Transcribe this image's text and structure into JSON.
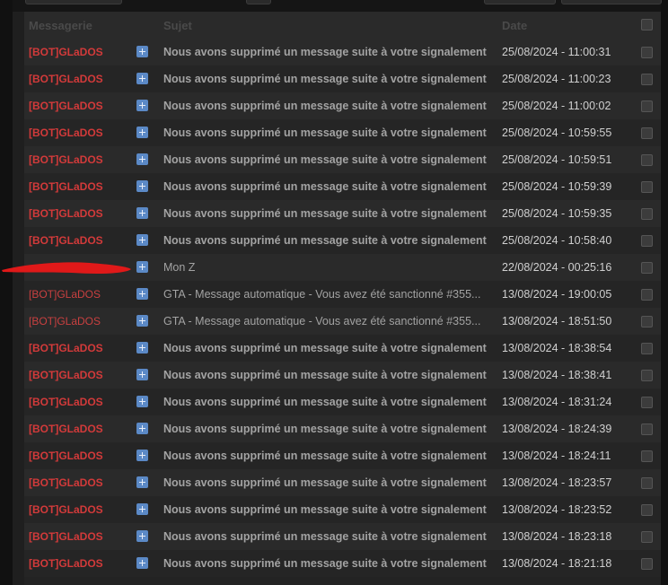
{
  "table": {
    "headers": {
      "sender": "Messagerie",
      "subject": "Sujet",
      "date": "Date"
    },
    "rows": [
      {
        "sender": "[BOT]GLaDOS",
        "subject": "Nous avons supprimé un message suite à votre signalement",
        "date": "25/08/2024 - 11:00:31",
        "unread": true
      },
      {
        "sender": "[BOT]GLaDOS",
        "subject": "Nous avons supprimé un message suite à votre signalement",
        "date": "25/08/2024 - 11:00:23",
        "unread": true
      },
      {
        "sender": "[BOT]GLaDOS",
        "subject": "Nous avons supprimé un message suite à votre signalement",
        "date": "25/08/2024 - 11:00:02",
        "unread": true
      },
      {
        "sender": "[BOT]GLaDOS",
        "subject": "Nous avons supprimé un message suite à votre signalement",
        "date": "25/08/2024 - 10:59:55",
        "unread": true
      },
      {
        "sender": "[BOT]GLaDOS",
        "subject": "Nous avons supprimé un message suite à votre signalement",
        "date": "25/08/2024 - 10:59:51",
        "unread": true
      },
      {
        "sender": "[BOT]GLaDOS",
        "subject": "Nous avons supprimé un message suite à votre signalement",
        "date": "25/08/2024 - 10:59:39",
        "unread": true
      },
      {
        "sender": "[BOT]GLaDOS",
        "subject": "Nous avons supprimé un message suite à votre signalement",
        "date": "25/08/2024 - 10:59:35",
        "unread": true
      },
      {
        "sender": "[BOT]GLaDOS",
        "subject": "Nous avons supprimé un message suite à votre signalement",
        "date": "25/08/2024 - 10:58:40",
        "unread": true
      },
      {
        "sender": "",
        "subject": "Mon Z",
        "date": "22/08/2024 - 00:25:16",
        "unread": false,
        "redacted": true
      },
      {
        "sender": "[BOT]GLaDOS",
        "subject": "GTA - Message automatique - Vous avez été sanctionné #355...",
        "date": "13/08/2024 - 19:00:05",
        "unread": false
      },
      {
        "sender": "[BOT]GLaDOS",
        "subject": "GTA - Message automatique - Vous avez été sanctionné #355...",
        "date": "13/08/2024 - 18:51:50",
        "unread": false
      },
      {
        "sender": "[BOT]GLaDOS",
        "subject": "Nous avons supprimé un message suite à votre signalement",
        "date": "13/08/2024 - 18:38:54",
        "unread": true
      },
      {
        "sender": "[BOT]GLaDOS",
        "subject": "Nous avons supprimé un message suite à votre signalement",
        "date": "13/08/2024 - 18:38:41",
        "unread": true
      },
      {
        "sender": "[BOT]GLaDOS",
        "subject": "Nous avons supprimé un message suite à votre signalement",
        "date": "13/08/2024 - 18:31:24",
        "unread": true
      },
      {
        "sender": "[BOT]GLaDOS",
        "subject": "Nous avons supprimé un message suite à votre signalement",
        "date": "13/08/2024 - 18:24:39",
        "unread": true
      },
      {
        "sender": "[BOT]GLaDOS",
        "subject": "Nous avons supprimé un message suite à votre signalement",
        "date": "13/08/2024 - 18:24:11",
        "unread": true
      },
      {
        "sender": "[BOT]GLaDOS",
        "subject": "Nous avons supprimé un message suite à votre signalement",
        "date": "13/08/2024 - 18:23:57",
        "unread": true
      },
      {
        "sender": "[BOT]GLaDOS",
        "subject": "Nous avons supprimé un message suite à votre signalement",
        "date": "13/08/2024 - 18:23:52",
        "unread": true
      },
      {
        "sender": "[BOT]GLaDOS",
        "subject": "Nous avons supprimé un message suite à votre signalement",
        "date": "13/08/2024 - 18:23:18",
        "unread": true
      },
      {
        "sender": "[BOT]GLaDOS",
        "subject": "Nous avons supprimé un message suite à votre signalement",
        "date": "13/08/2024 - 18:21:18",
        "unread": true
      }
    ]
  },
  "colors": {
    "sender": "#d23a3a",
    "expand_icon": "#5b89c6",
    "redaction_mark": "#e01919"
  },
  "icons": {
    "expand": "plus-square-icon",
    "select": "checkbox"
  }
}
